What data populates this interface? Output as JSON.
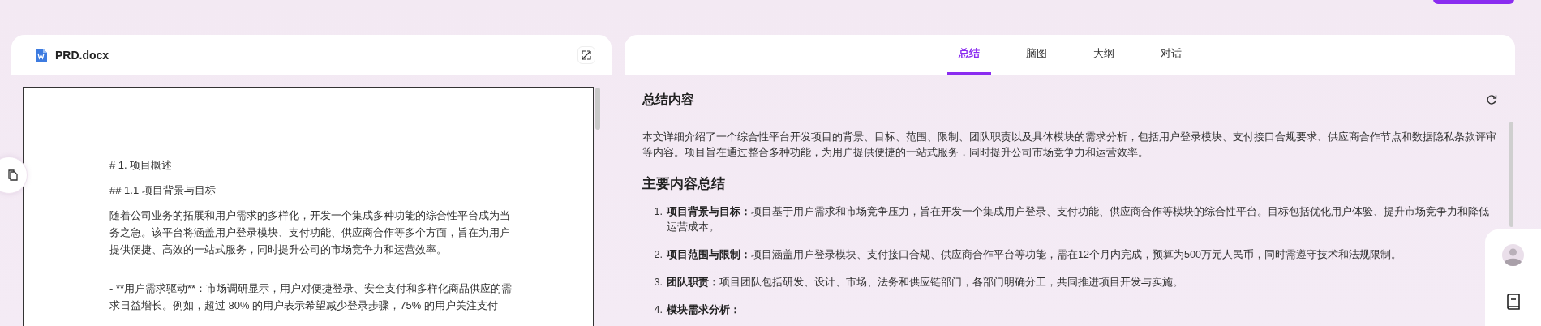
{
  "document": {
    "file_name": "PRD.docx",
    "blocks": [
      {
        "kind": "heading",
        "text": "# 1.  项目概述"
      },
      {
        "kind": "heading",
        "text": "## 1.1  项目背景与目标"
      },
      {
        "kind": "paragraph",
        "text": "随着公司业务的拓展和用户需求的多样化，开发一个集成多种功能的综合性平台成为当务之急。该平台将涵盖用户登录模块、支付功能、供应商合作等多个方面，旨在为用户提供便捷、高效的一站式服务，同时提升公司的市场竞争力和运营效率。"
      },
      {
        "kind": "bullet",
        "text": "- **用户需求驱动**：市场调研显示，用户对便捷登录、安全支付和多样化商品供应的需求日益增长。例如，超过  80%  的用户表示希望减少登录步骤，75%  的用户关注支付"
      }
    ]
  },
  "tabs": [
    {
      "label": "总结",
      "selected": true
    },
    {
      "label": "脑图",
      "selected": false
    },
    {
      "label": "大纲",
      "selected": false
    },
    {
      "label": "对话",
      "selected": false
    }
  ],
  "summary": {
    "title": "总结内容",
    "intro": "本文详细介绍了一个综合性平台开发项目的背景、目标、范围、限制、团队职责以及具体模块的需求分析，包括用户登录模块、支付接口合规要求、供应商合作节点和数据隐私条款评审等内容。项目旨在通过整合多种功能，为用户提供便捷的一站式服务，同时提升公司市场竞争力和运营效率。",
    "heading": "主要内容总结",
    "items": [
      {
        "number": "1.",
        "label": "项目背景与目标：",
        "text": "项目基于用户需求和市场竞争压力，旨在开发一个集成用户登录、支付功能、供应商合作等模块的综合性平台。目标包括优化用户体验、提升市场竞争力和降低运营成本。"
      },
      {
        "number": "2.",
        "label": "项目范围与限制：",
        "text": "项目涵盖用户登录模块、支付接口合规、供应商合作平台等功能，需在12个月内完成，预算为500万元人民币，同时需遵守技术和法规限制。"
      },
      {
        "number": "3.",
        "label": "团队职责：",
        "text": "项目团队包括研发、设计、市场、法务和供应链部门，各部门明确分工，共同推进项目开发与实施。"
      },
      {
        "number": "4.",
        "label": "模块需求分析："
      }
    ]
  }
}
